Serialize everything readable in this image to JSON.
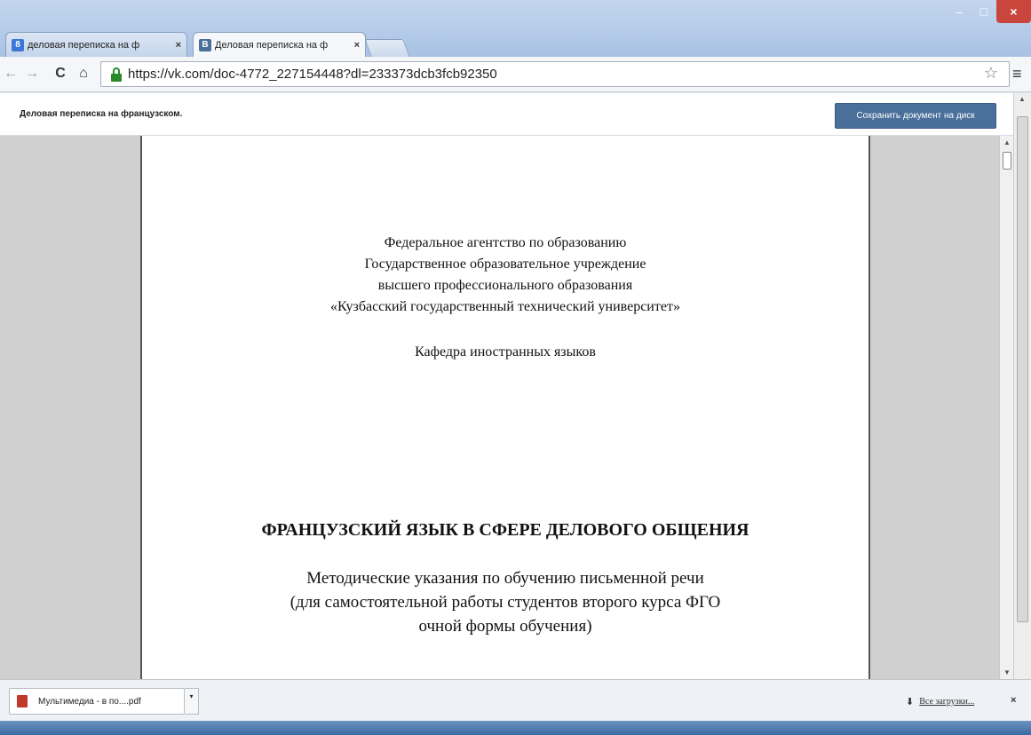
{
  "browser": {
    "tabs": [
      {
        "label": "деловая переписка на ф",
        "favicon": "8",
        "favicon_color": "#3b77d8",
        "close": "×"
      },
      {
        "label": "Деловая переписка на ф",
        "favicon": "В",
        "favicon_color": "#4a6f9b",
        "close": "×"
      }
    ],
    "window_buttons": {
      "minimize": "–",
      "maximize": "□",
      "close": "×"
    },
    "nav": {
      "back": "←",
      "forward": "→",
      "reload": "C",
      "home": "⌂"
    },
    "url": "https://vk.com/doc-4772_227154448?dl=233373dcb3fcb92350",
    "star": "☆",
    "menu": "≡"
  },
  "vk": {
    "doc_title": "Деловая переписка на французском.",
    "save_button": "Сохранить документ на диск"
  },
  "document": {
    "header_lines": [
      "Федеральное агентство по образованию",
      "Государственное образовательное учреждение",
      "высшего профессионального образования",
      "«Кузбасский государственный технический университет»"
    ],
    "department": "Кафедра иностранных языков",
    "title": "ФРАНЦУЗСКИЙ ЯЗЫК В СФЕРЕ ДЕЛОВОГО ОБЩЕНИЯ",
    "subtitle_lines": [
      "Методические указания по обучению письменной речи",
      "(для самостоятельной работы студентов второго курса ФГО",
      "очной формы обучения)"
    ]
  },
  "downloads": {
    "item_label": "Мультимедиа - в по....pdf",
    "item_arrow": "▾",
    "all_label": "Все загрузки...",
    "all_icon": "⬇",
    "close": "×"
  },
  "colors": {
    "save_button_bg": "#4a6f9b",
    "close_button_bg": "#c9463c",
    "lock_green": "#2a8a2a"
  }
}
